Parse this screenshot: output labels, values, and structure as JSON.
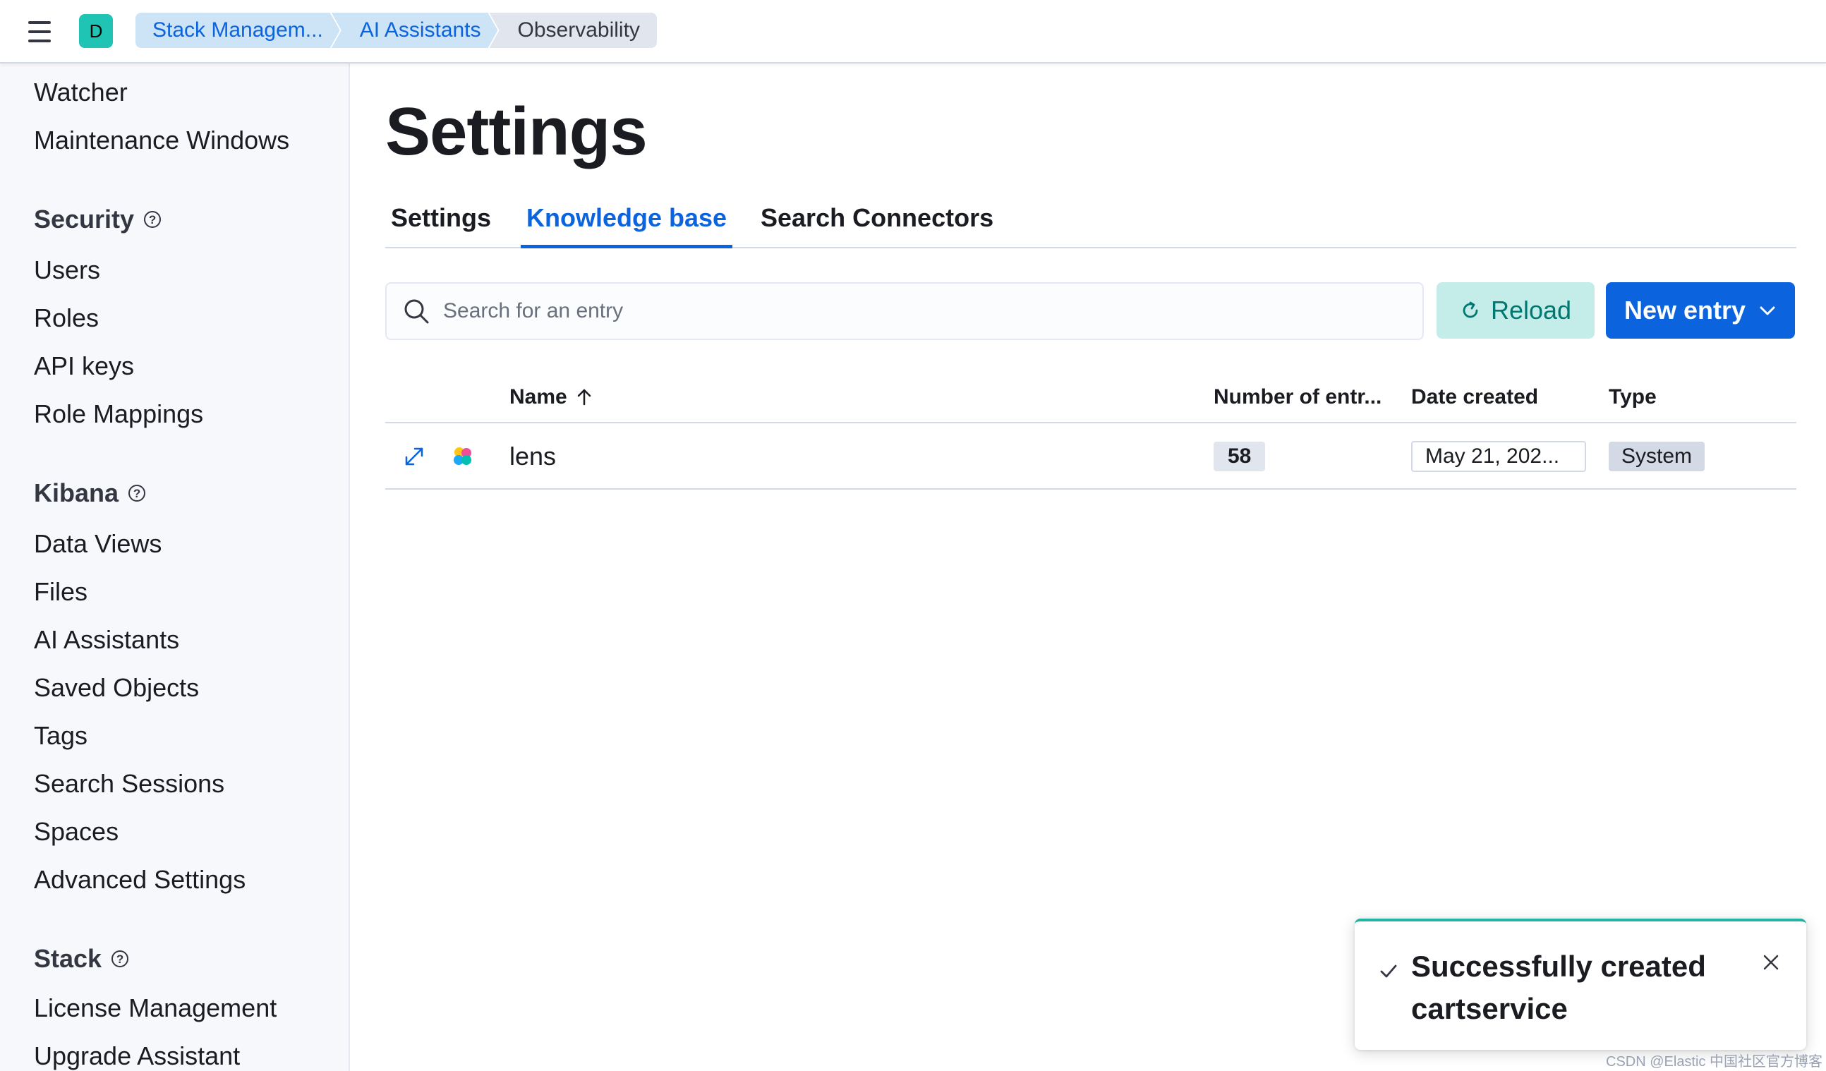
{
  "header": {
    "avatar_initial": "D",
    "breadcrumbs": [
      "Stack Managem...",
      "AI Assistants",
      "Observability"
    ]
  },
  "sidebar": {
    "top_items": [
      "Watcher",
      "Maintenance Windows"
    ],
    "sections": [
      {
        "heading": "Security",
        "items": [
          "Users",
          "Roles",
          "API keys",
          "Role Mappings"
        ]
      },
      {
        "heading": "Kibana",
        "items": [
          "Data Views",
          "Files",
          "AI Assistants",
          "Saved Objects",
          "Tags",
          "Search Sessions",
          "Spaces",
          "Advanced Settings"
        ]
      },
      {
        "heading": "Stack",
        "items": [
          "License Management",
          "Upgrade Assistant"
        ]
      }
    ]
  },
  "main": {
    "title": "Settings",
    "tabs": [
      {
        "label": "Settings",
        "active": false
      },
      {
        "label": "Knowledge base",
        "active": true
      },
      {
        "label": "Search Connectors",
        "active": false
      }
    ],
    "search": {
      "placeholder": "Search for an entry",
      "value": ""
    },
    "reload_label": "Reload",
    "new_entry_label": "New entry"
  },
  "table": {
    "columns": [
      "Name",
      "Number of entr...",
      "Date created",
      "Type"
    ],
    "sort": {
      "column": "Name",
      "direction": "ascending"
    },
    "rows": [
      {
        "name": "lens",
        "count": "58",
        "date": "May 21, 202...",
        "type": "System"
      }
    ]
  },
  "toast": {
    "title": "Successfully created cartservice",
    "status": "success"
  },
  "watermark": "CSDN @Elastic 中国社区官方博客",
  "colors": {
    "primary": "#0b64dd",
    "success": "#20b4a4",
    "reload_bg": "#c4ede9",
    "reload_text": "#007871"
  }
}
